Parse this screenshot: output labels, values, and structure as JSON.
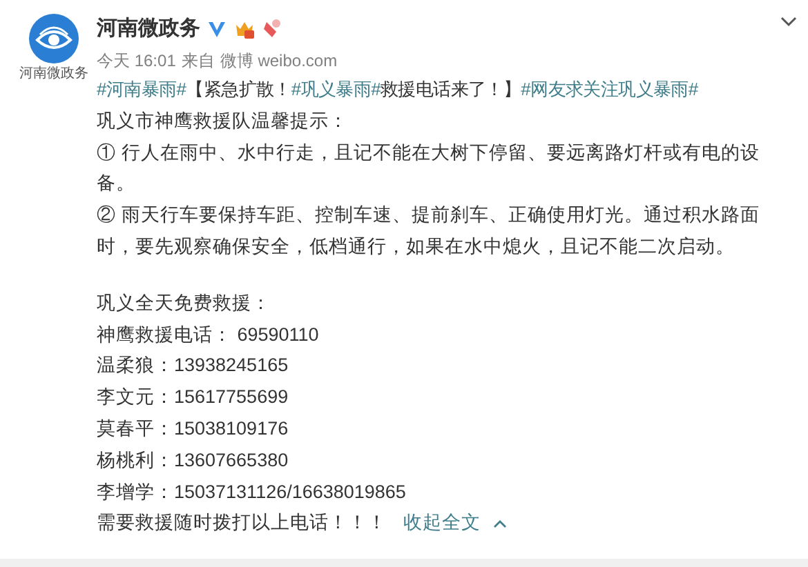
{
  "author": {
    "name": "河南微政务",
    "avatar_caption": "河南微政务",
    "time": "今天 16:01",
    "source_prefix": "来自",
    "source": "微博 weibo.com"
  },
  "headline": [
    {
      "kind": "hashtag",
      "text": "#河南暴雨#"
    },
    {
      "kind": "text",
      "text": "【紧急扩散！"
    },
    {
      "kind": "hashtag",
      "text": "#巩义暴雨#"
    },
    {
      "kind": "text",
      "text": "救援电话来了！】"
    },
    {
      "kind": "hashtag",
      "text": "#网友求关注巩义暴雨#"
    }
  ],
  "paragraphs": [
    "巩义市神鹰救援队温馨提示：",
    "① 行人在雨中、水中行走，且记不能在大树下停留、要远离路灯杆或有电的设备。",
    "② 雨天行车要保持车距、控制车速、提前刹车、正确使用灯光。通过积水路面时，要先观察确保安全，低档通行，如果在水中熄火，且记不能二次启动。"
  ],
  "contacts_title": "巩义全天免费救援：",
  "contacts": [
    {
      "name": "神鹰救援电话：",
      "phone": " 69590110"
    },
    {
      "name": "温柔狼：",
      "phone": "13938245165"
    },
    {
      "name": "李文元：",
      "phone": "15617755699"
    },
    {
      "name": "莫春平：",
      "phone": "15038109176"
    },
    {
      "name": "杨桃利：",
      "phone": "13607665380"
    },
    {
      "name": "李增学：",
      "phone": "15037131126/16638019865"
    }
  ],
  "closing": "需要救援随时拨打以上电话！！！",
  "collapse_link": "收起全文"
}
